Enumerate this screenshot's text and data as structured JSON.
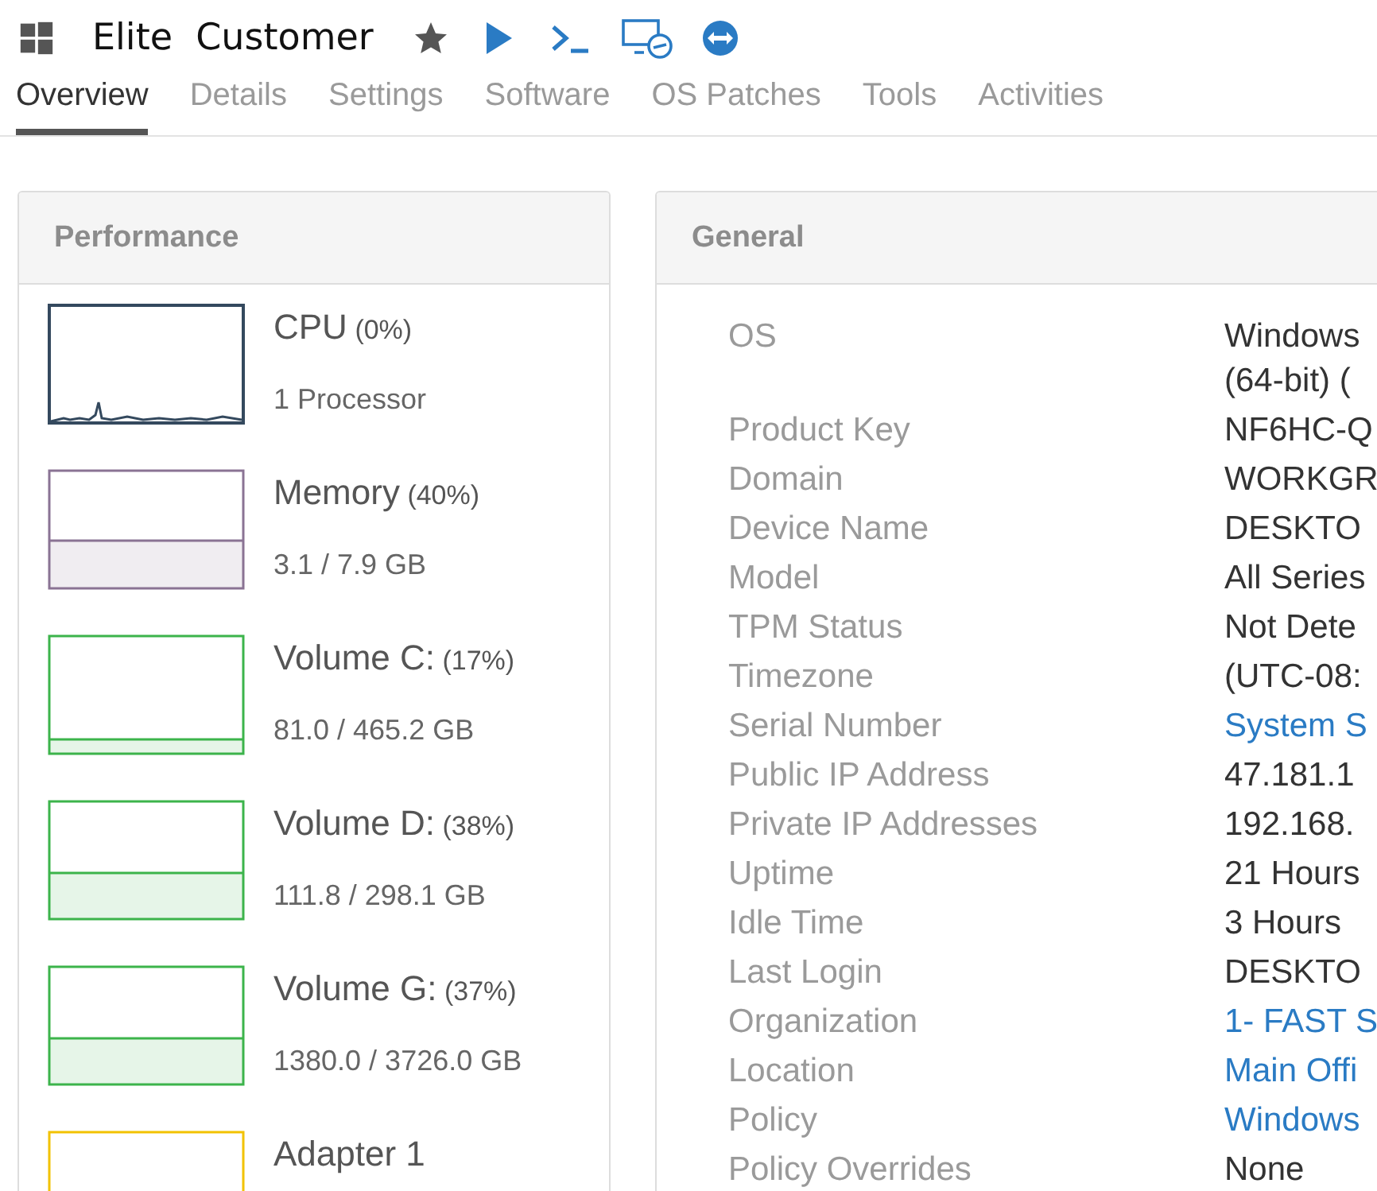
{
  "header": {
    "title": "Elite  Customer"
  },
  "tabs": [
    {
      "label": "Overview",
      "selected": true
    },
    {
      "label": "Details",
      "selected": false
    },
    {
      "label": "Settings",
      "selected": false
    },
    {
      "label": "Software",
      "selected": false
    },
    {
      "label": "OS Patches",
      "selected": false
    },
    {
      "label": "Tools",
      "selected": false
    },
    {
      "label": "Activities",
      "selected": false
    }
  ],
  "performance": {
    "title": "Performance",
    "metrics": [
      {
        "kind": "sparkline",
        "name": "CPU",
        "percent": "(0%)",
        "detail": "1 Processor",
        "color": "#34495e"
      },
      {
        "kind": "area",
        "name": "Memory",
        "percent": "(40%)",
        "detail": "3.1 / 7.9 GB",
        "color": "#8a7394"
      },
      {
        "kind": "area",
        "name": "Volume C:",
        "percent": "(17%)",
        "detail": "81.0 / 465.2 GB",
        "color": "#3cb44b"
      },
      {
        "kind": "area",
        "name": "Volume D:",
        "percent": "(38%)",
        "detail": "111.8 / 298.1 GB",
        "color": "#3cb44b"
      },
      {
        "kind": "area",
        "name": "Volume G:",
        "percent": "(37%)",
        "detail": "1380.0 / 3726.0 GB",
        "color": "#3cb44b"
      },
      {
        "kind": "cut",
        "name": "Adapter 1",
        "color": "#f2c200"
      }
    ]
  },
  "general": {
    "title": "General",
    "rows": [
      {
        "label": "OS",
        "value": "Windows",
        "value_line_2": "(64-bit) (",
        "kind": "text"
      },
      {
        "label": "Product Key",
        "value": "NF6HC-Q",
        "kind": "text"
      },
      {
        "label": "Domain",
        "value": "WORKGR",
        "kind": "text"
      },
      {
        "label": "Device Name",
        "value": "DESKTO",
        "kind": "text"
      },
      {
        "label": "Model",
        "value": "All Series",
        "kind": "text"
      },
      {
        "label": "TPM Status",
        "value": "Not Dete",
        "kind": "text"
      },
      {
        "label": "Timezone",
        "value": "(UTC-08:",
        "kind": "text"
      },
      {
        "label": "Serial Number",
        "value": "System S",
        "kind": "link"
      },
      {
        "label": "Public IP Address",
        "value": "47.181.1",
        "kind": "text"
      },
      {
        "label": "Private IP Addresses",
        "value": "192.168.",
        "kind": "text"
      },
      {
        "label": "Uptime",
        "value": "21 Hours",
        "kind": "text"
      },
      {
        "label": "Idle Time",
        "value": "3 Hours",
        "kind": "text"
      },
      {
        "label": "Last Login",
        "value": "DESKTO",
        "kind": "text"
      },
      {
        "label": "Organization",
        "value": "1- FAST S",
        "kind": "link"
      },
      {
        "label": "Location",
        "value": "Main Offi",
        "kind": "link"
      },
      {
        "label": "Policy",
        "value": "Windows",
        "kind": "link"
      },
      {
        "label": "Policy Overrides",
        "value": "None",
        "kind": "text"
      }
    ]
  }
}
